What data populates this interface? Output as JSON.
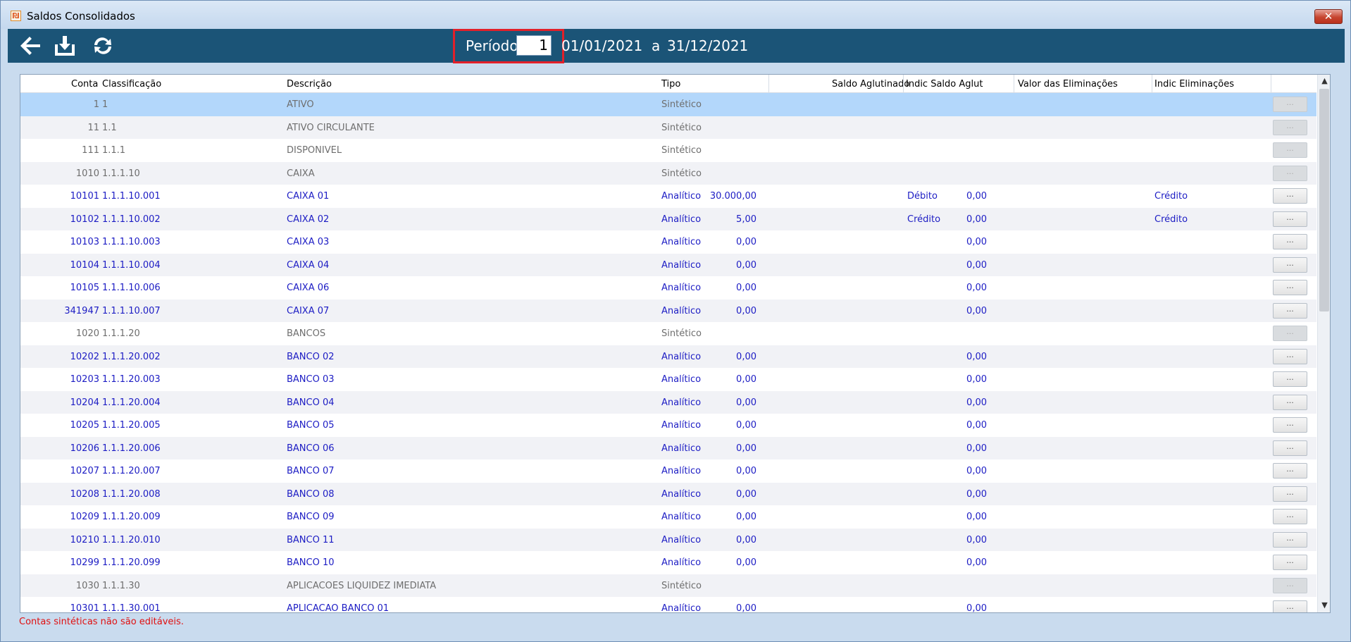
{
  "window": {
    "title": "Saldos Consolidados",
    "close_label": "✕"
  },
  "toolbar": {
    "period_label": "Período",
    "period_value": "1",
    "date_start": "01/01/2021",
    "date_separator": "a",
    "date_end": "31/12/2021",
    "icons": [
      "back-arrow-icon",
      "download-icon",
      "refresh-icon"
    ]
  },
  "grid": {
    "columns": [
      "Conta",
      "Classificação",
      "Descrição",
      "Tipo",
      "Saldo Aglutinado",
      "Indic Saldo Aglut",
      "Valor das Eliminações",
      "Indic Eliminações"
    ],
    "edit_label": "...",
    "rows": [
      {
        "conta": "1",
        "classificacao": "1",
        "descricao": "ATIVO",
        "tipo": "Sintético",
        "saldo": "",
        "indic_saldo": "",
        "valor_elim": "",
        "indic_elim": ""
      },
      {
        "conta": "11",
        "classificacao": "1.1",
        "descricao": "ATIVO CIRCULANTE",
        "tipo": "Sintético",
        "saldo": "",
        "indic_saldo": "",
        "valor_elim": "",
        "indic_elim": ""
      },
      {
        "conta": "111",
        "classificacao": "1.1.1",
        "descricao": "DISPONIVEL",
        "tipo": "Sintético",
        "saldo": "",
        "indic_saldo": "",
        "valor_elim": "",
        "indic_elim": ""
      },
      {
        "conta": "1010",
        "classificacao": "1.1.1.10",
        "descricao": "CAIXA",
        "tipo": "Sintético",
        "saldo": "",
        "indic_saldo": "",
        "valor_elim": "",
        "indic_elim": ""
      },
      {
        "conta": "10101",
        "classificacao": "1.1.1.10.001",
        "descricao": "CAIXA 01",
        "tipo": "Analítico",
        "saldo": "30.000,00",
        "indic_saldo": "Débito",
        "valor_elim": "0,00",
        "indic_elim": "Crédito"
      },
      {
        "conta": "10102",
        "classificacao": "1.1.1.10.002",
        "descricao": "CAIXA 02",
        "tipo": "Analítico",
        "saldo": "5,00",
        "indic_saldo": "Crédito",
        "valor_elim": "0,00",
        "indic_elim": "Crédito"
      },
      {
        "conta": "10103",
        "classificacao": "1.1.1.10.003",
        "descricao": "CAIXA 03",
        "tipo": "Analítico",
        "saldo": "0,00",
        "indic_saldo": "",
        "valor_elim": "0,00",
        "indic_elim": ""
      },
      {
        "conta": "10104",
        "classificacao": "1.1.1.10.004",
        "descricao": "CAIXA 04",
        "tipo": "Analítico",
        "saldo": "0,00",
        "indic_saldo": "",
        "valor_elim": "0,00",
        "indic_elim": ""
      },
      {
        "conta": "10105",
        "classificacao": "1.1.1.10.006",
        "descricao": "CAIXA 06",
        "tipo": "Analítico",
        "saldo": "0,00",
        "indic_saldo": "",
        "valor_elim": "0,00",
        "indic_elim": ""
      },
      {
        "conta": "341947",
        "classificacao": "1.1.1.10.007",
        "descricao": "CAIXA 07",
        "tipo": "Analítico",
        "saldo": "0,00",
        "indic_saldo": "",
        "valor_elim": "0,00",
        "indic_elim": ""
      },
      {
        "conta": "1020",
        "classificacao": "1.1.1.20",
        "descricao": "BANCOS",
        "tipo": "Sintético",
        "saldo": "",
        "indic_saldo": "",
        "valor_elim": "",
        "indic_elim": ""
      },
      {
        "conta": "10202",
        "classificacao": "1.1.1.20.002",
        "descricao": "BANCO 02",
        "tipo": "Analítico",
        "saldo": "0,00",
        "indic_saldo": "",
        "valor_elim": "0,00",
        "indic_elim": ""
      },
      {
        "conta": "10203",
        "classificacao": "1.1.1.20.003",
        "descricao": "BANCO 03",
        "tipo": "Analítico",
        "saldo": "0,00",
        "indic_saldo": "",
        "valor_elim": "0,00",
        "indic_elim": ""
      },
      {
        "conta": "10204",
        "classificacao": "1.1.1.20.004",
        "descricao": "BANCO 04",
        "tipo": "Analítico",
        "saldo": "0,00",
        "indic_saldo": "",
        "valor_elim": "0,00",
        "indic_elim": ""
      },
      {
        "conta": "10205",
        "classificacao": "1.1.1.20.005",
        "descricao": "BANCO 05",
        "tipo": "Analítico",
        "saldo": "0,00",
        "indic_saldo": "",
        "valor_elim": "0,00",
        "indic_elim": ""
      },
      {
        "conta": "10206",
        "classificacao": "1.1.1.20.006",
        "descricao": "BANCO 06",
        "tipo": "Analítico",
        "saldo": "0,00",
        "indic_saldo": "",
        "valor_elim": "0,00",
        "indic_elim": ""
      },
      {
        "conta": "10207",
        "classificacao": "1.1.1.20.007",
        "descricao": "BANCO 07",
        "tipo": "Analítico",
        "saldo": "0,00",
        "indic_saldo": "",
        "valor_elim": "0,00",
        "indic_elim": ""
      },
      {
        "conta": "10208",
        "classificacao": "1.1.1.20.008",
        "descricao": "BANCO 08",
        "tipo": "Analítico",
        "saldo": "0,00",
        "indic_saldo": "",
        "valor_elim": "0,00",
        "indic_elim": ""
      },
      {
        "conta": "10209",
        "classificacao": "1.1.1.20.009",
        "descricao": "BANCO 09",
        "tipo": "Analítico",
        "saldo": "0,00",
        "indic_saldo": "",
        "valor_elim": "0,00",
        "indic_elim": ""
      },
      {
        "conta": "10210",
        "classificacao": "1.1.1.20.010",
        "descricao": "BANCO 11",
        "tipo": "Analítico",
        "saldo": "0,00",
        "indic_saldo": "",
        "valor_elim": "0,00",
        "indic_elim": ""
      },
      {
        "conta": "10299",
        "classificacao": "1.1.1.20.099",
        "descricao": "BANCO 10",
        "tipo": "Analítico",
        "saldo": "0,00",
        "indic_saldo": "",
        "valor_elim": "0,00",
        "indic_elim": ""
      },
      {
        "conta": "1030",
        "classificacao": "1.1.1.30",
        "descricao": "APLICACOES LIQUIDEZ IMEDIATA",
        "tipo": "Sintético",
        "saldo": "",
        "indic_saldo": "",
        "valor_elim": "",
        "indic_elim": ""
      },
      {
        "conta": "10301",
        "classificacao": "1.1.1.30.001",
        "descricao": "APLICACAO BANCO 01",
        "tipo": "Analítico",
        "saldo": "0,00",
        "indic_saldo": "",
        "valor_elim": "0,00",
        "indic_elim": ""
      }
    ],
    "selected_row": 0
  },
  "status": {
    "message": "Contas sintéticas não são editáveis."
  },
  "colors": {
    "toolbar_bg": "#1b5477",
    "selected_row": "#b3d7fb",
    "analytic_text": "#1c1cc4",
    "synthetic_text": "#6e6e6e",
    "status_text": "#e01010",
    "highlight_box": "#e2202a"
  }
}
